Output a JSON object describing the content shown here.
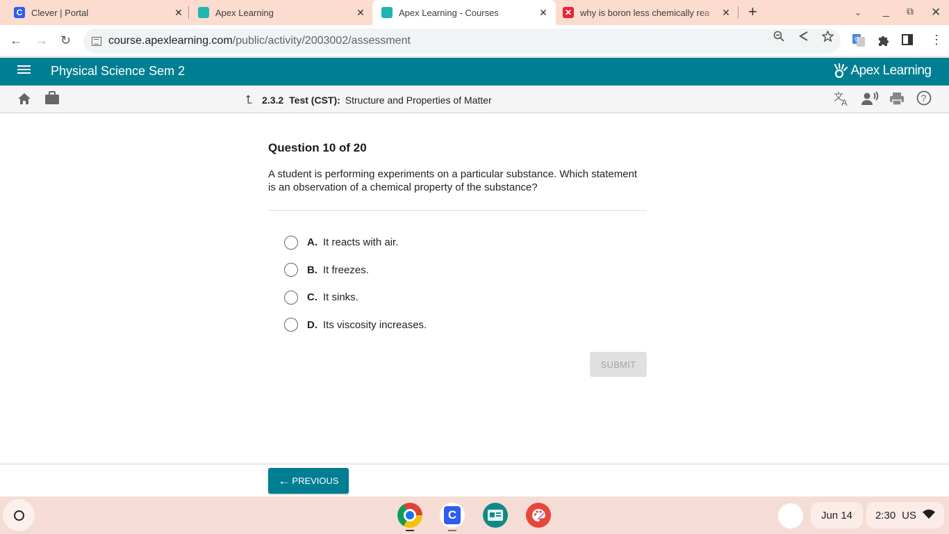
{
  "browser": {
    "tabs": [
      {
        "title": "Clever | Portal",
        "favicon": "clever-icon",
        "active": false
      },
      {
        "title": "Apex Learning",
        "favicon": "apex-icon",
        "active": false
      },
      {
        "title": "Apex Learning - Courses",
        "favicon": "apex-icon",
        "active": true
      },
      {
        "title": "why is boron less chemically rea",
        "favicon": "quizlet-icon",
        "active": false
      }
    ],
    "url_host": "course.apexlearning.com",
    "url_path": "/public/activity/2003002/assessment"
  },
  "app": {
    "course_title": "Physical Science Sem 2",
    "brand": "Apex Learning",
    "brand_color": "#007f92"
  },
  "breadcrumb": {
    "number": "2.3.2",
    "type": "Test (CST):",
    "title": "Structure and Properties of Matter"
  },
  "question": {
    "header": "Question 10 of 20",
    "text": "A student is performing experiments on a particular substance. Which statement is an observation of a chemical property of the substance?",
    "choices": [
      {
        "letter": "A.",
        "text": "It reacts with air.",
        "selected": false
      },
      {
        "letter": "B.",
        "text": "It freezes.",
        "selected": false
      },
      {
        "letter": "C.",
        "text": "It sinks.",
        "selected": false
      },
      {
        "letter": "D.",
        "text": "Its viscosity increases.",
        "selected": false
      }
    ],
    "submit_label": "SUBMIT"
  },
  "footer": {
    "previous_label": "PREVIOUS"
  },
  "shelf": {
    "apps": [
      "chrome-icon",
      "clever-icon",
      "classroom-icon",
      "canvas-icon"
    ],
    "date": "Jun 14",
    "time": "2:30",
    "locale": "US"
  }
}
